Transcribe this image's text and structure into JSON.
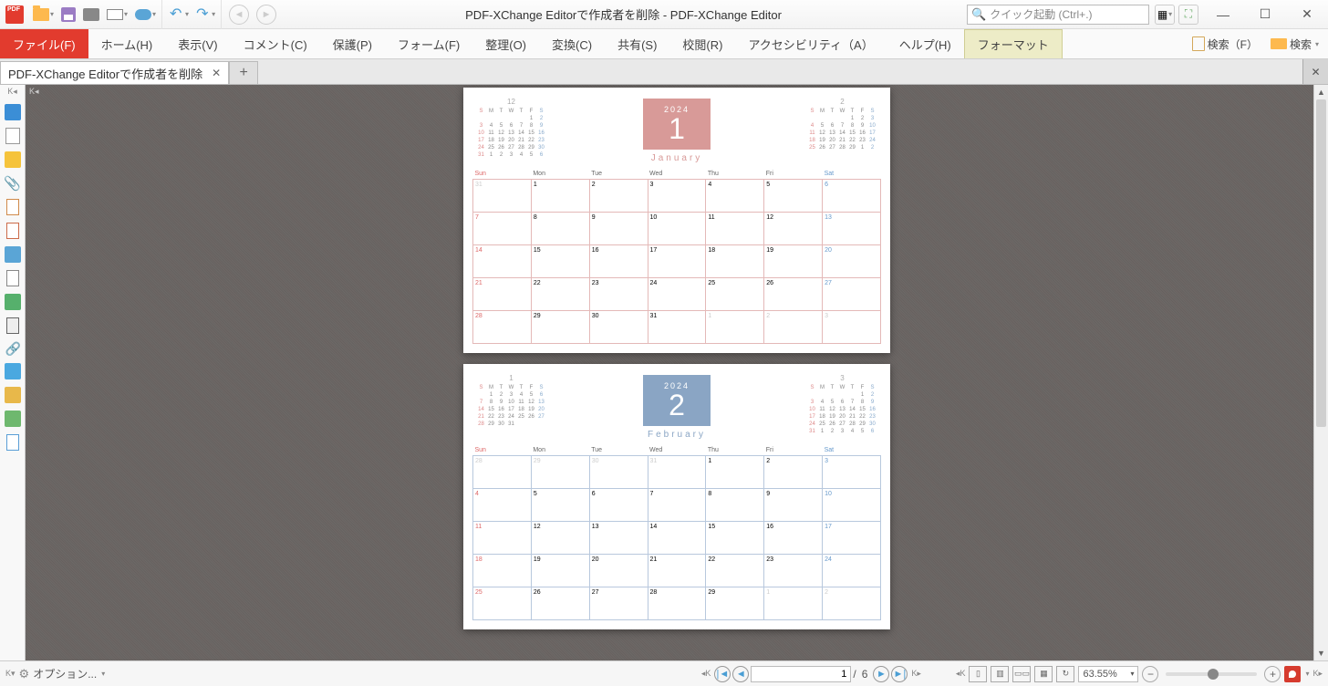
{
  "app": {
    "title": "PDF-XChange Editorで作成者を削除 - PDF-XChange Editor"
  },
  "quicklaunch": {
    "placeholder": "クイック起動 (Ctrl+.)"
  },
  "ribbon": {
    "file": "ファイル(F)",
    "tabs": [
      "ホーム(H)",
      "表示(V)",
      "コメント(C)",
      "保護(P)",
      "フォーム(F)",
      "整理(O)",
      "変換(C)",
      "共有(S)",
      "校閲(R)",
      "アクセシビリティ（A）",
      "ヘルプ(H)",
      "フォーマット"
    ],
    "active_index": 11,
    "search": "検索（F）",
    "search_files": "検索"
  },
  "doctab": {
    "title": "PDF-XChange Editorで作成者を削除"
  },
  "status": {
    "options": "オプション..."
  },
  "pagenav": {
    "current": "1",
    "total": "6",
    "sep": "/"
  },
  "zoom": {
    "value": "63.55%"
  },
  "cal": {
    "year": "2024",
    "days_short": [
      "S",
      "M",
      "T",
      "W",
      "T",
      "F",
      "S"
    ],
    "days_long": [
      "Sun",
      "Mon",
      "Tue",
      "Wed",
      "Thu",
      "Fri",
      "Sat"
    ],
    "jan": {
      "num": "1",
      "name": "January",
      "prev_title": "12",
      "next_title": "2",
      "prev_grid": [
        [
          "",
          "",
          "",
          "",
          "",
          "1",
          "2"
        ],
        [
          "3",
          "4",
          "5",
          "6",
          "7",
          "8",
          "9"
        ],
        [
          "10",
          "11",
          "12",
          "13",
          "14",
          "15",
          "16"
        ],
        [
          "17",
          "18",
          "19",
          "20",
          "21",
          "22",
          "23"
        ],
        [
          "24",
          "25",
          "26",
          "27",
          "28",
          "29",
          "30"
        ],
        [
          "31",
          "1",
          "2",
          "3",
          "4",
          "5",
          "6"
        ]
      ],
      "next_grid": [
        [
          "",
          "",
          "",
          "",
          "1",
          "2",
          "3"
        ],
        [
          "4",
          "5",
          "6",
          "7",
          "8",
          "9",
          "10"
        ],
        [
          "11",
          "12",
          "13",
          "14",
          "15",
          "16",
          "17"
        ],
        [
          "18",
          "19",
          "20",
          "21",
          "22",
          "23",
          "24"
        ],
        [
          "25",
          "26",
          "27",
          "28",
          "29",
          "1",
          "2"
        ]
      ],
      "big_grid": [
        [
          "31",
          "1",
          "2",
          "3",
          "4",
          "5",
          "6"
        ],
        [
          "7",
          "8",
          "9",
          "10",
          "11",
          "12",
          "13"
        ],
        [
          "14",
          "15",
          "16",
          "17",
          "18",
          "19",
          "20"
        ],
        [
          "21",
          "22",
          "23",
          "24",
          "25",
          "26",
          "27"
        ],
        [
          "28",
          "29",
          "30",
          "31",
          "1",
          "2",
          "3"
        ]
      ]
    },
    "feb": {
      "num": "2",
      "name": "February",
      "prev_title": "1",
      "next_title": "3",
      "prev_grid": [
        [
          "",
          "1",
          "2",
          "3",
          "4",
          "5",
          "6"
        ],
        [
          "7",
          "8",
          "9",
          "10",
          "11",
          "12",
          "13"
        ],
        [
          "14",
          "15",
          "16",
          "17",
          "18",
          "19",
          "20"
        ],
        [
          "21",
          "22",
          "23",
          "24",
          "25",
          "26",
          "27"
        ],
        [
          "28",
          "29",
          "30",
          "31",
          "",
          "",
          ""
        ]
      ],
      "next_grid": [
        [
          "",
          "",
          "",
          "",
          "",
          "1",
          "2"
        ],
        [
          "3",
          "4",
          "5",
          "6",
          "7",
          "8",
          "9"
        ],
        [
          "10",
          "11",
          "12",
          "13",
          "14",
          "15",
          "16"
        ],
        [
          "17",
          "18",
          "19",
          "20",
          "21",
          "22",
          "23"
        ],
        [
          "24",
          "25",
          "26",
          "27",
          "28",
          "29",
          "30"
        ],
        [
          "31",
          "1",
          "2",
          "3",
          "4",
          "5",
          "6"
        ]
      ],
      "big_grid": [
        [
          "28",
          "29",
          "30",
          "31",
          "1",
          "2",
          "3"
        ],
        [
          "4",
          "5",
          "6",
          "7",
          "8",
          "9",
          "10"
        ],
        [
          "11",
          "12",
          "13",
          "14",
          "15",
          "16",
          "17"
        ],
        [
          "18",
          "19",
          "20",
          "21",
          "22",
          "23",
          "24"
        ],
        [
          "25",
          "26",
          "27",
          "28",
          "29",
          "1",
          "2"
        ]
      ]
    }
  }
}
